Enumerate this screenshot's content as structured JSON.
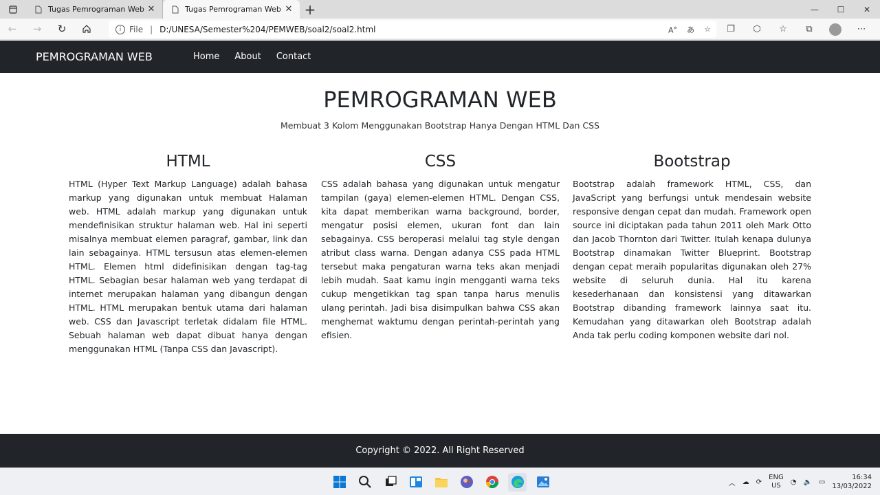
{
  "browser": {
    "tabs": [
      {
        "title": "Tugas Pemrograman Web",
        "active": false
      },
      {
        "title": "Tugas Pemrograman Web Ahmad",
        "active": true
      }
    ],
    "address": {
      "scheme": "File",
      "url": "D:/UNESA/Semester%204/PEMWEB/soal2/soal2.html"
    },
    "url_icons": [
      "read-aloud-icon",
      "translate-icon",
      "favorite-add-icon"
    ],
    "toolbar_icons": [
      "collections-icon",
      "extensions-icon",
      "favorites-icon",
      "collections-panel-icon",
      "profile-icon",
      "more-icon"
    ]
  },
  "site": {
    "brand": "PEMROGRAMAN WEB",
    "nav": [
      "Home",
      "About",
      "Contact"
    ],
    "hero": {
      "title": "PEMROGRAMAN WEB",
      "subtitle": "Membuat 3 Kolom Menggunakan Bootstrap Hanya Dengan HTML Dan CSS"
    },
    "columns": [
      {
        "heading": "HTML",
        "text": "HTML (Hyper Text Markup Language) adalah bahasa markup yang digunakan untuk membuat Halaman web. HTML adalah markup yang digunakan untuk mendefinisikan struktur halaman web. Hal ini seperti misalnya membuat elemen paragraf, gambar, link dan lain sebagainya. HTML tersusun atas elemen-elemen HTML. Elemen html didefinisikan dengan tag-tag HTML. Sebagian besar halaman web yang terdapat di internet merupakan halaman yang dibangun dengan HTML. HTML merupakan bentuk utama dari halaman web. CSS dan Javascript terletak didalam file HTML. Sebuah halaman web dapat dibuat hanya dengan menggunakan HTML (Tanpa CSS dan Javascript)."
      },
      {
        "heading": "CSS",
        "text": "CSS adalah bahasa yang digunakan untuk mengatur tampilan (gaya) elemen-elemen HTML. Dengan CSS, kita dapat memberikan warna background, border, mengatur posisi elemen, ukuran font dan lain sebagainya. CSS beroperasi melalui tag style dengan atribut class warna. Dengan adanya CSS pada HTML tersebut maka pengaturan warna teks akan menjadi lebih mudah. Saat kamu ingin mengganti warna teks cukup mengetikkan tag span tanpa harus menulis ulang perintah. Jadi bisa disimpulkan bahwa CSS akan menghemat waktumu dengan perintah-perintah yang efisien."
      },
      {
        "heading": "Bootstrap",
        "text": "Bootstrap adalah framework HTML, CSS, dan JavaScript yang berfungsi untuk mendesain website responsive dengan cepat dan mudah. Framework open source ini diciptakan pada tahun 2011 oleh Mark Otto dan Jacob Thornton dari Twitter. Itulah kenapa dulunya Bootstrap dinamakan Twitter Blueprint. Bootstrap dengan cepat meraih popularitas digunakan oleh 27% website di seluruh dunia. Hal itu karena kesederhanaan dan konsistensi yang ditawarkan Bootstrap dibanding framework lainnya saat itu. Kemudahan yang ditawarkan oleh Bootstrap adalah Anda tak perlu coding komponen website dari nol."
      }
    ],
    "footer": "Copyright © 2022. All Right Reserved"
  },
  "taskbar": {
    "apps": [
      "windows-start-icon",
      "search-icon",
      "task-view-icon",
      "widgets-icon",
      "file-explorer-icon",
      "teams-icon",
      "chrome-icon",
      "edge-icon",
      "photos-icon"
    ],
    "lang_line1": "ENG",
    "lang_line2": "US",
    "time": "16:34",
    "date": "13/03/2022"
  },
  "colors": {
    "navbar_bg": "#212529",
    "footer_bg": "#212529",
    "text": "#212529"
  }
}
